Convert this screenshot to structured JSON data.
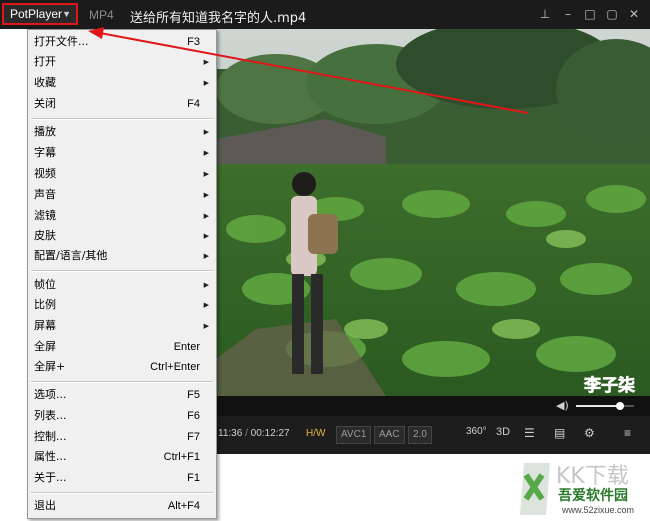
{
  "titlebar": {
    "app_button": "PotPlayer",
    "format": "MP4",
    "title": "送给所有知道我名字的人.mp4"
  },
  "menu": {
    "items": [
      {
        "label": "打开文件...",
        "shortcut": "F3",
        "submenu": false
      },
      {
        "label": "打开",
        "shortcut": "",
        "submenu": true
      },
      {
        "label": "收藏",
        "shortcut": "",
        "submenu": true
      },
      {
        "label": "关闭",
        "shortcut": "F4",
        "submenu": false
      },
      {
        "label": "播放",
        "shortcut": "",
        "submenu": true
      },
      {
        "label": "字幕",
        "shortcut": "",
        "submenu": true
      },
      {
        "label": "视频",
        "shortcut": "",
        "submenu": true
      },
      {
        "label": "声音",
        "shortcut": "",
        "submenu": true
      },
      {
        "label": "滤镜",
        "shortcut": "",
        "submenu": true
      },
      {
        "label": "皮肤",
        "shortcut": "",
        "submenu": true
      },
      {
        "label": "配置/语言/其他",
        "shortcut": "",
        "submenu": true
      },
      {
        "label": "帧位",
        "shortcut": "",
        "submenu": true
      },
      {
        "label": "比例",
        "shortcut": "",
        "submenu": true
      },
      {
        "label": "屏幕",
        "shortcut": "",
        "submenu": true
      },
      {
        "label": "全屏",
        "shortcut": "Enter",
        "submenu": false
      },
      {
        "label": "全屏+",
        "shortcut": "Ctrl+Enter",
        "submenu": false
      },
      {
        "label": "选项...",
        "shortcut": "F5",
        "submenu": false
      },
      {
        "label": "列表...",
        "shortcut": "F6",
        "submenu": false
      },
      {
        "label": "控制...",
        "shortcut": "F7",
        "submenu": false
      },
      {
        "label": "属性...",
        "shortcut": "Ctrl+F1",
        "submenu": false
      },
      {
        "label": "关于...",
        "shortcut": "F1",
        "submenu": false
      },
      {
        "label": "退出",
        "shortcut": "Alt+F4",
        "submenu": false
      }
    ]
  },
  "video": {
    "subtitle_overlay": "李子柒"
  },
  "controls": {
    "time_current": "11:36",
    "time_sep": "/",
    "time_total": "00:12:27",
    "hw": "H/W",
    "codec_video": "AVC1",
    "codec_audio": "AAC",
    "channels": "2.0",
    "btn_360": "360°",
    "btn_3d": "3D",
    "volume_level": 0.75
  },
  "watermark": {
    "logo": "KK下载",
    "site": "吾爱软件园",
    "url": "www.52zixue.com"
  },
  "colors": {
    "highlight_red": "#e0161b",
    "titlebar_bg": "#1b1b1b",
    "menu_bg": "#f0f0f0",
    "hw_color": "#e7b23a"
  }
}
